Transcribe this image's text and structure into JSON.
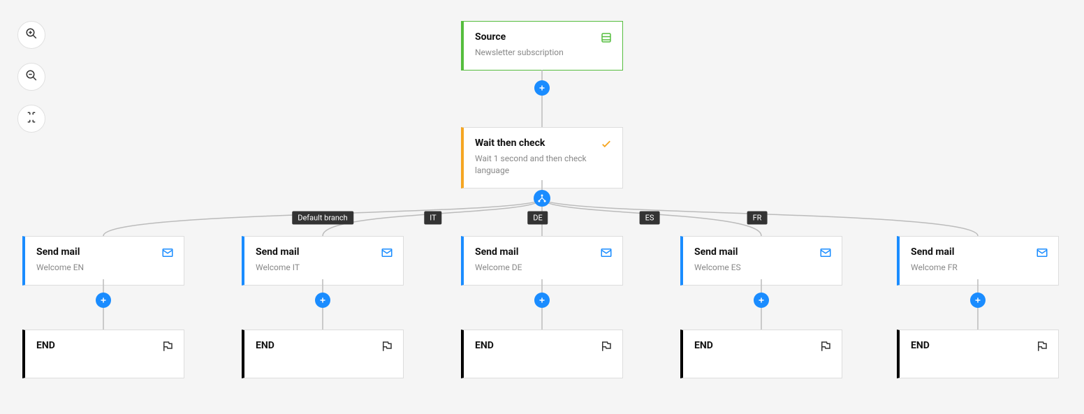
{
  "nodes": {
    "source": {
      "title": "Source",
      "subtitle": "Newsletter subscription"
    },
    "wait": {
      "title": "Wait then check",
      "subtitle": "Wait 1 second and then check language"
    },
    "mail_en": {
      "title": "Send mail",
      "subtitle": "Welcome EN"
    },
    "mail_it": {
      "title": "Send mail",
      "subtitle": "Welcome IT"
    },
    "mail_de": {
      "title": "Send mail",
      "subtitle": "Welcome DE"
    },
    "mail_es": {
      "title": "Send mail",
      "subtitle": "Welcome ES"
    },
    "mail_fr": {
      "title": "Send mail",
      "subtitle": "Welcome FR"
    },
    "end": {
      "title": "END"
    }
  },
  "branches": {
    "default": "Default branch",
    "it": "IT",
    "de": "DE",
    "es": "ES",
    "fr": "FR"
  }
}
